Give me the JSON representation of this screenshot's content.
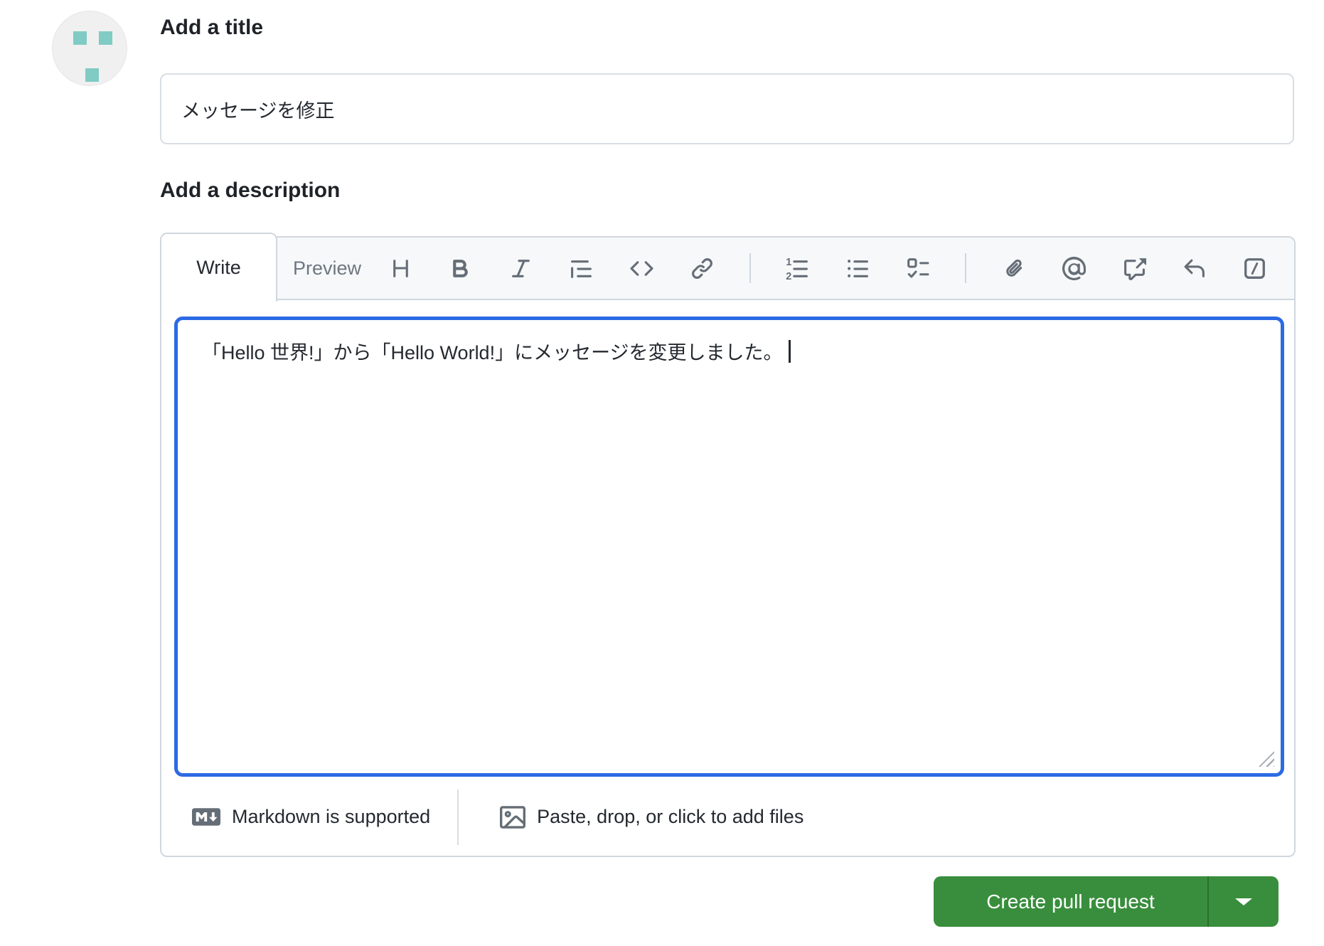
{
  "avatar": {
    "bg_color": "#f0f0f0",
    "square_color": "#80cbc4"
  },
  "title_section": {
    "heading": "Add a title",
    "value": "メッセージを修正"
  },
  "description_section": {
    "heading": "Add a description",
    "tabs": {
      "write": "Write",
      "preview": "Preview"
    },
    "toolbar_icons": [
      "heading",
      "bold",
      "italic",
      "quote",
      "code",
      "link",
      "divider",
      "list-ordered",
      "list-unordered",
      "tasklist",
      "divider",
      "paperclip",
      "mention",
      "cross-reference",
      "reply",
      "slash-command"
    ],
    "body_text": "「Hello 世界!」から「Hello World!」にメッセージを変更しました。",
    "footer": {
      "markdown_label": "Markdown is supported",
      "attach_label": "Paste, drop, or click to add files"
    }
  },
  "actions": {
    "create_pull_request_label": "Create pull request"
  },
  "colors": {
    "focus_border": "#2c6ae4",
    "primary_button": "#388e3c",
    "box_border": "#d0d7de",
    "strip_bg": "#f6f8fa",
    "icon_gray": "#656d76",
    "muted_text": "#6e7781",
    "text": "#1f2328"
  }
}
